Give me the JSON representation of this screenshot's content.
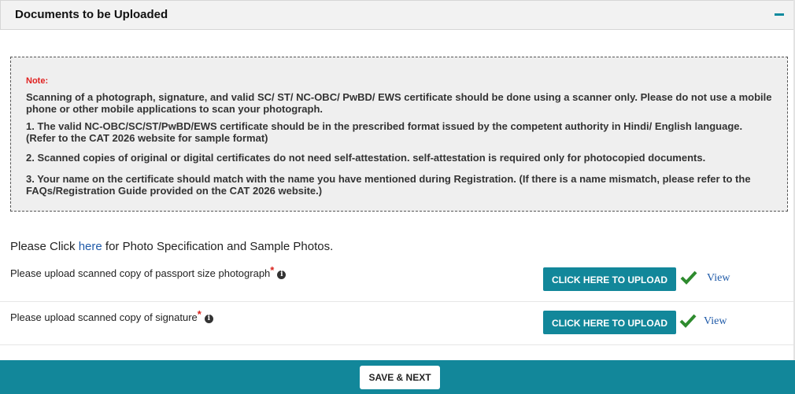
{
  "panel": {
    "title": "Documents to be Uploaded",
    "collapse_icon": "minus-icon"
  },
  "note": {
    "label": "Note:",
    "paragraphs": [
      "Scanning of a photograph, signature, and valid SC/ ST/ NC-OBC/ PwBD/ EWS certificate should be done using a scanner only. Please do not use a mobile phone or other mobile applications to scan your photograph.",
      "1. The valid NC-OBC/SC/ST/PwBD/EWS certificate should be in the prescribed format issued by the competent authority in Hindi/ English language. (Refer to the CAT 2026 website for sample format)",
      "2. Scanned copies of original or digital certificates do not need self-attestation. self-attestation is required only for photocopied documents.",
      "3. Your name on the certificate should match with the name you have mentioned during Registration. (If there is a name mismatch, please refer to the FAQs/Registration Guide provided on the CAT 2026 website.)"
    ]
  },
  "photo_spec": {
    "prefix": "Please Click ",
    "link": "here",
    "suffix": " for Photo Specification and Sample Photos."
  },
  "uploads": [
    {
      "label": "Please upload scanned copy of passport size photograph",
      "required_mark": "*",
      "info_icon": "i",
      "button": "CLICK HERE TO UPLOAD",
      "status_icon": "check-icon",
      "view": "View"
    },
    {
      "label": "Please upload scanned copy of signature",
      "required_mark": "*",
      "info_icon": "i",
      "button": "CLICK HERE TO UPLOAD",
      "status_icon": "check-icon",
      "view": "View"
    }
  ],
  "footer": {
    "save_next": "SAVE & NEXT"
  },
  "colors": {
    "accent": "#12879a",
    "required": "#d9221c",
    "note_label": "#e0201f",
    "check": "#2e8b2e",
    "link": "#1f5aa8"
  }
}
